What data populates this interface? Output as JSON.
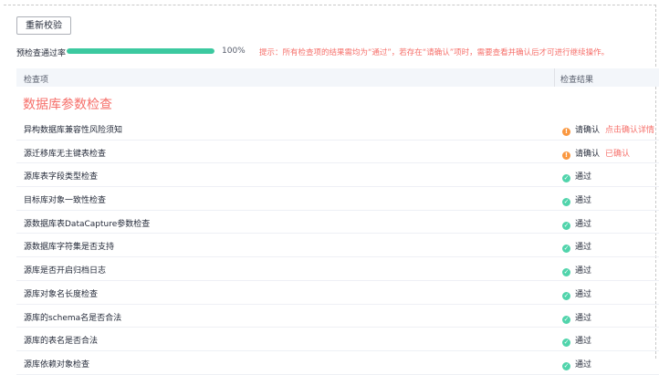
{
  "toolbar": {
    "recheck_label": "重新校验"
  },
  "progress": {
    "label": "预检查通过率",
    "value_text": "100%",
    "fraction": 1.0,
    "color": "#3cc9a0"
  },
  "hint": "提示：所有检查项的结果需均为“通过”，若存在“请确认”项时，需要查看并确认后才可进行继续操作。",
  "table": {
    "col_item": "检查项",
    "col_result": "检查结果",
    "section_title": "数据库参数检查",
    "rows": [
      {
        "name": "异构数据库兼容性风险须知",
        "status": "请确认",
        "status_type": "warning",
        "action": "点击确认详情"
      },
      {
        "name": "源迁移库无主键表检查",
        "status": "请确认",
        "status_type": "warning",
        "action": "已确认"
      },
      {
        "name": "源库表字段类型检查",
        "status": "通过",
        "status_type": "pass"
      },
      {
        "name": "目标库对象一致性检查",
        "status": "通过",
        "status_type": "pass"
      },
      {
        "name": "源数据库表DataCapture参数检查",
        "status": "通过",
        "status_type": "pass"
      },
      {
        "name": "源数据库字符集是否支持",
        "status": "通过",
        "status_type": "pass"
      },
      {
        "name": "源库是否开启归档日志",
        "status": "通过",
        "status_type": "pass"
      },
      {
        "name": "源库对象名长度检查",
        "status": "通过",
        "status_type": "pass"
      },
      {
        "name": "源库的schema名是否合法",
        "status": "通过",
        "status_type": "pass"
      },
      {
        "name": "源库的表名是否合法",
        "status": "通过",
        "status_type": "pass"
      },
      {
        "name": "源库依赖对象检查",
        "status": "通过",
        "status_type": "pass"
      }
    ]
  },
  "colors": {
    "accent": "#f66f6a",
    "warning": "#fa9841",
    "pass": "#50d4ab"
  }
}
